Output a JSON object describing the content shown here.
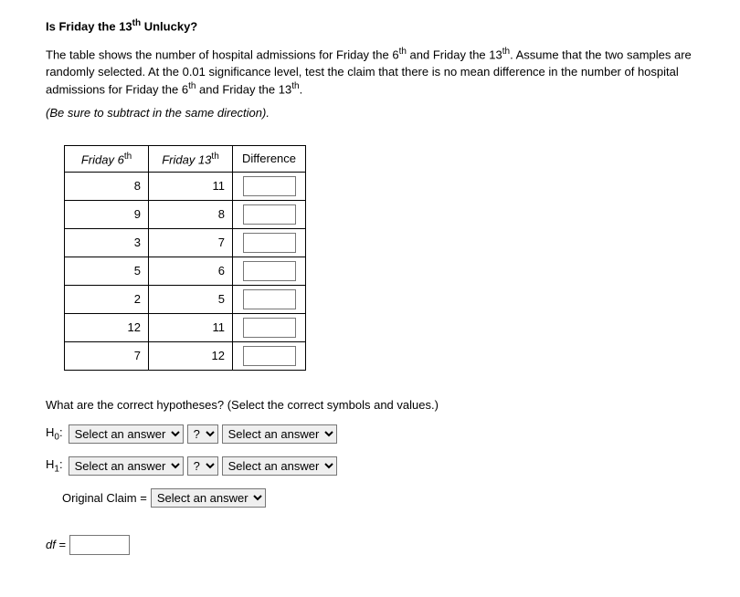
{
  "title_part1": "Is Friday the 13",
  "title_sup": "th",
  "title_part2": " Unlucky?",
  "description_part1": "The table shows the number of hospital admissions for Friday the 6",
  "description_sup1": "th",
  "description_part2": " and Friday the 13",
  "description_sup2": "th",
  "description_part3": ". Assume that the two samples are randomly selected. At the 0.01 significance level, test the claim that there is no mean difference in the number of hospital admissions for Friday the 6",
  "description_sup3": "th",
  "description_part4": " and Friday the 13",
  "description_sup4": "th",
  "description_part5": ".",
  "instruction": "(Be sure to subtract in the same direction).",
  "table": {
    "header1_text": "Friday 6",
    "header1_sup": "th",
    "header2_text": "Friday 13",
    "header2_sup": "th",
    "header3": "Difference",
    "rows": [
      {
        "c1": "8",
        "c2": "11"
      },
      {
        "c1": "9",
        "c2": "8"
      },
      {
        "c1": "3",
        "c2": "7"
      },
      {
        "c1": "5",
        "c2": "6"
      },
      {
        "c1": "2",
        "c2": "5"
      },
      {
        "c1": "12",
        "c2": "11"
      },
      {
        "c1": "7",
        "c2": "12"
      }
    ]
  },
  "question": "What are the correct hypotheses? (Select the correct symbols and values.)",
  "h0_label_pre": "H",
  "h0_label_sub": "0",
  "h0_label_post": ":",
  "h1_label_pre": "H",
  "h1_label_sub": "1",
  "h1_label_post": ":",
  "select_answer": "Select an answer",
  "select_q": "?",
  "orig_claim_label": "Original Claim =",
  "df_label_italic": "df",
  "df_label_eq": " ="
}
